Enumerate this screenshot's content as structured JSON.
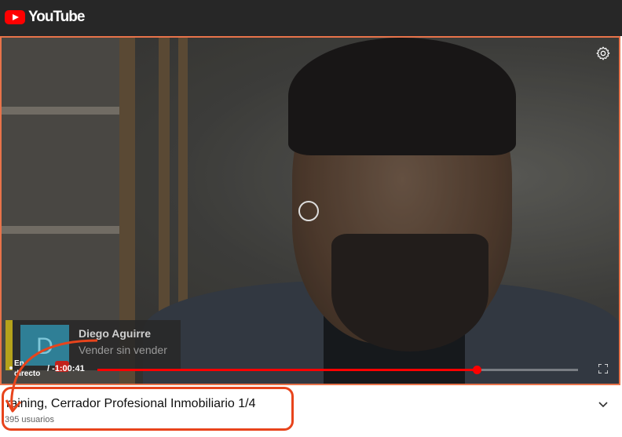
{
  "header": {
    "logo_text": "YouTube"
  },
  "player": {
    "endcard": {
      "channel_name": "Diego Aguirre",
      "video_title": "Vender sin vender",
      "thumb_letter": "D"
    },
    "live_label_line1": "En",
    "live_label_line2": "directo",
    "time": "/ -1:00:41",
    "progress": 0.79
  },
  "video": {
    "title": "raining, Cerrador Profesional Inmobiliario 1/4",
    "viewers": "395 usuarios"
  },
  "colors": {
    "accent": "#ff0000",
    "annotation": "#e8441c"
  }
}
